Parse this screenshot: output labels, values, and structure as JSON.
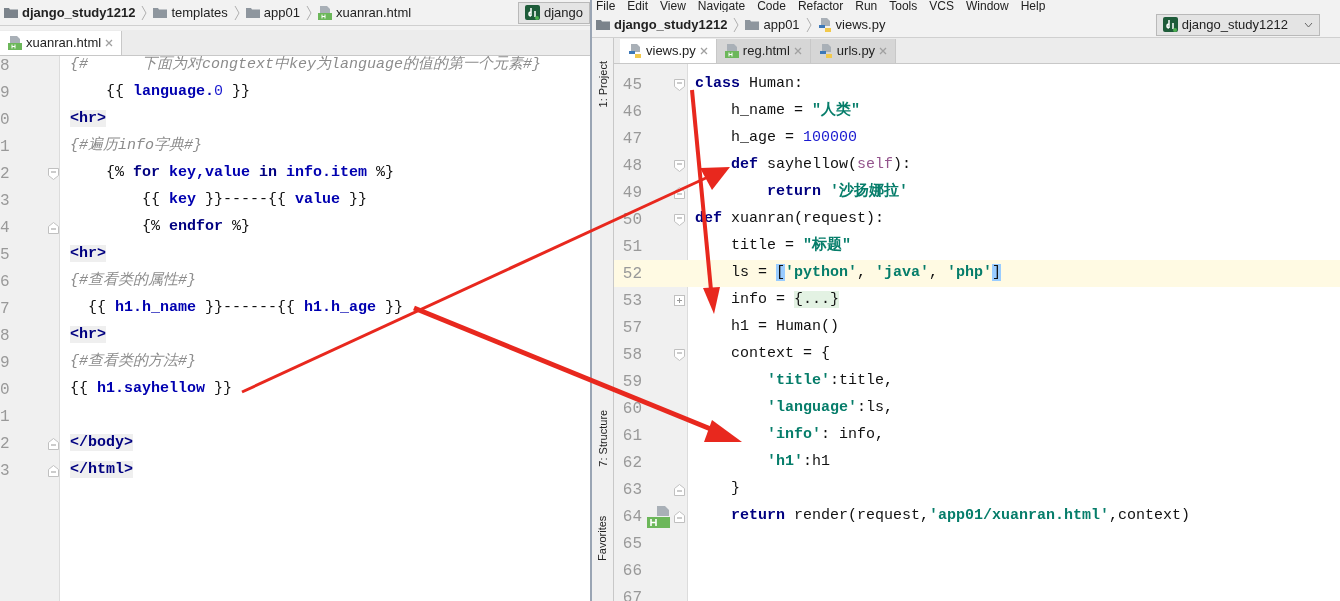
{
  "left_window": {
    "breadcrumbs": [
      {
        "label": "django_study1212",
        "kind": "project"
      },
      {
        "label": "templates",
        "kind": "folder"
      },
      {
        "label": "app01",
        "kind": "folder"
      },
      {
        "label": "xuanran.html",
        "kind": "html"
      }
    ],
    "run_config": "django",
    "tabs": [
      {
        "label": "xuanran.html",
        "kind": "html",
        "selected": true
      }
    ],
    "lines": [
      {
        "number": "8",
        "tokens": [
          {
            "kind": "comment",
            "text": "{#      下面为对congtext中key为language的值的第一个元素#}"
          }
        ]
      },
      {
        "number": "9",
        "tokens": [
          {
            "kind": "plain",
            "text": "    {{ "
          },
          {
            "kind": "var",
            "text": "language."
          },
          {
            "kind": "number",
            "text": "0"
          },
          {
            "kind": "plain",
            "text": " }}"
          }
        ]
      },
      {
        "number": "0",
        "tokens": [
          {
            "kind": "tag",
            "text": "<hr>"
          }
        ]
      },
      {
        "number": "1",
        "tokens": [
          {
            "kind": "comment",
            "text": "{#遍历info字典#}"
          }
        ]
      },
      {
        "number": "2",
        "fold": {
          "kind": "start"
        },
        "tokens": [
          {
            "kind": "plain",
            "text": "    {% "
          },
          {
            "kind": "keyword",
            "text": "for "
          },
          {
            "kind": "var",
            "text": "key,value "
          },
          {
            "kind": "keyword",
            "text": "in "
          },
          {
            "kind": "var",
            "text": "info.item"
          },
          {
            "kind": "plain",
            "text": " %}"
          }
        ]
      },
      {
        "number": "3",
        "tokens": [
          {
            "kind": "plain",
            "text": "        {{ "
          },
          {
            "kind": "var",
            "text": "key"
          },
          {
            "kind": "plain",
            "text": " }}-----{{ "
          },
          {
            "kind": "var",
            "text": "value"
          },
          {
            "kind": "plain",
            "text": " }}"
          }
        ]
      },
      {
        "number": "4",
        "fold": {
          "kind": "end"
        },
        "tokens": [
          {
            "kind": "plain",
            "text": "        {% "
          },
          {
            "kind": "keyword",
            "text": "endfor"
          },
          {
            "kind": "plain",
            "text": " %}"
          }
        ]
      },
      {
        "number": "5",
        "tokens": [
          {
            "kind": "tag",
            "text": "<hr>"
          }
        ]
      },
      {
        "number": "6",
        "tokens": [
          {
            "kind": "comment",
            "text": "{#查看类的属性#}"
          }
        ]
      },
      {
        "number": "7",
        "tokens": [
          {
            "kind": "plain",
            "text": "  {{ "
          },
          {
            "kind": "var",
            "text": "h1.h_name"
          },
          {
            "kind": "plain",
            "text": " }}------{{ "
          },
          {
            "kind": "var",
            "text": "h1.h_age"
          },
          {
            "kind": "plain",
            "text": " }}"
          }
        ]
      },
      {
        "number": "8",
        "tokens": [
          {
            "kind": "tag",
            "text": "<hr>"
          }
        ]
      },
      {
        "number": "9",
        "tokens": [
          {
            "kind": "comment",
            "text": "{#查看类的方法#}"
          }
        ]
      },
      {
        "number": "0",
        "tokens": [
          {
            "kind": "plain",
            "text": "{{ "
          },
          {
            "kind": "var",
            "text": "h1.sayhellow"
          },
          {
            "kind": "plain",
            "text": " }}"
          }
        ]
      },
      {
        "number": "1"
      },
      {
        "number": "2",
        "fold": {
          "kind": "end"
        },
        "tokens": [
          {
            "kind": "tag",
            "text": "</body>"
          }
        ]
      },
      {
        "number": "3",
        "fold": {
          "kind": "end"
        },
        "tokens": [
          {
            "kind": "tag",
            "text": "</html>"
          }
        ]
      }
    ]
  },
  "right_window": {
    "menu": [
      "File",
      "Edit",
      "View",
      "Navigate",
      "Code",
      "Refactor",
      "Run",
      "Tools",
      "VCS",
      "Window",
      "Help"
    ],
    "breadcrumbs": [
      {
        "label": "django_study1212",
        "kind": "project"
      },
      {
        "label": "app01",
        "kind": "folder"
      },
      {
        "label": "views.py",
        "kind": "python"
      }
    ],
    "run_config": "django_study1212",
    "tool_strip": [
      "1: Project",
      "7: Structure",
      "Favorites"
    ],
    "tabs": [
      {
        "label": "views.py",
        "kind": "python",
        "selected": true
      },
      {
        "label": "reg.html",
        "kind": "html",
        "selected": false
      },
      {
        "label": "urls.py",
        "kind": "python",
        "selected": false
      }
    ],
    "lines": [
      {
        "number": "45",
        "fold": {
          "kind": "start"
        },
        "tokens": [
          {
            "kind": "keyword",
            "text": "class"
          },
          {
            "kind": "plain",
            "text": " Human:"
          }
        ]
      },
      {
        "number": "46",
        "tokens": [
          {
            "kind": "plain",
            "text": "    h_name = "
          },
          {
            "kind": "string",
            "text": "\"人类\""
          }
        ]
      },
      {
        "number": "47",
        "tokens": [
          {
            "kind": "plain",
            "text": "    h_age = "
          },
          {
            "kind": "number",
            "text": "100000"
          }
        ]
      },
      {
        "number": "48",
        "fold": {
          "kind": "start"
        },
        "tokens": [
          {
            "kind": "keyword",
            "text": "    def"
          },
          {
            "kind": "plain",
            "text": " sayhellow("
          },
          {
            "kind": "param",
            "text": "self"
          },
          {
            "kind": "plain",
            "text": "):"
          }
        ]
      },
      {
        "number": "49",
        "fold": {
          "kind": "end"
        },
        "tokens": [
          {
            "kind": "keyword",
            "text": "        return "
          },
          {
            "kind": "string",
            "text": "'沙扬娜拉'"
          }
        ]
      },
      {
        "number": "50",
        "fold": {
          "kind": "start"
        },
        "tokens": [
          {
            "kind": "keyword",
            "text": "def"
          },
          {
            "kind": "plain",
            "text": " xuanran(request):"
          }
        ]
      },
      {
        "number": "51",
        "tokens": [
          {
            "kind": "plain",
            "text": "    title = "
          },
          {
            "kind": "string",
            "text": "\"标题\""
          }
        ]
      },
      {
        "number": "52",
        "current": true,
        "tokens": [
          {
            "kind": "plain",
            "text": "    ls = "
          },
          {
            "kind": "match",
            "text": "["
          },
          {
            "kind": "string",
            "text": "'python'"
          },
          {
            "kind": "plain",
            "text": ", "
          },
          {
            "kind": "string",
            "text": "'java'"
          },
          {
            "kind": "plain",
            "text": ", "
          },
          {
            "kind": "string",
            "text": "'php'"
          },
          {
            "kind": "match",
            "text": "]"
          }
        ]
      },
      {
        "number": "53",
        "fold": {
          "kind": "plus"
        },
        "tokens": [
          {
            "kind": "plain",
            "text": "    info = "
          },
          {
            "kind": "folded",
            "text": "{...}"
          }
        ]
      },
      {
        "number": "57",
        "tokens": [
          {
            "kind": "plain",
            "text": "    h1 = Human()"
          }
        ]
      },
      {
        "number": "58",
        "fold": {
          "kind": "start"
        },
        "tokens": [
          {
            "kind": "plain",
            "text": "    context = {"
          }
        ]
      },
      {
        "number": "59",
        "tokens": [
          {
            "kind": "string",
            "text": "        'title'"
          },
          {
            "kind": "plain",
            "text": ":title,"
          }
        ]
      },
      {
        "number": "60",
        "tokens": [
          {
            "kind": "string",
            "text": "        'language'"
          },
          {
            "kind": "plain",
            "text": ":ls,"
          }
        ]
      },
      {
        "number": "61",
        "tokens": [
          {
            "kind": "string",
            "text": "        'info'"
          },
          {
            "kind": "plain",
            "text": ": info,"
          }
        ]
      },
      {
        "number": "62",
        "tokens": [
          {
            "kind": "string",
            "text": "        'h1'"
          },
          {
            "kind": "plain",
            "text": ":h1"
          }
        ]
      },
      {
        "number": "63",
        "fold": {
          "kind": "end"
        },
        "tokens": [
          {
            "kind": "plain",
            "text": "    }"
          }
        ]
      },
      {
        "number": "64",
        "fold": {
          "kind": "end"
        },
        "gutter_icon": {
          "kind": "html"
        },
        "tokens": [
          {
            "kind": "keyword",
            "text": "    return"
          },
          {
            "kind": "plain",
            "text": " render(request,"
          },
          {
            "kind": "string",
            "text": "'app01/xuanran.html'"
          },
          {
            "kind": "plain",
            "text": ",context)"
          }
        ]
      },
      {
        "number": "65"
      },
      {
        "number": "66"
      },
      {
        "number": "67"
      }
    ]
  }
}
